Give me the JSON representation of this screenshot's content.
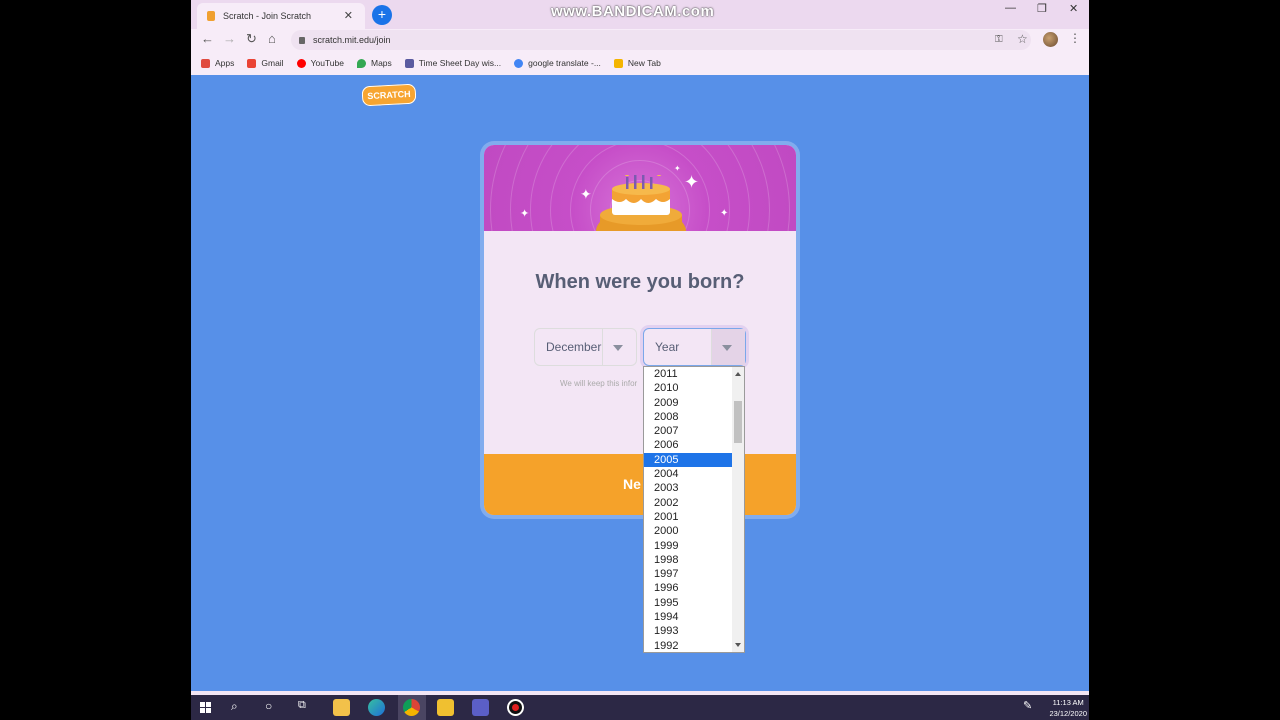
{
  "browser": {
    "tab_title": "Scratch - Join Scratch",
    "tab_close": "✕",
    "new_tab": "+",
    "watermark": "www.BANDICAM.com",
    "url": "scratch.mit.edu/join",
    "bookmarks": [
      {
        "label": "Apps",
        "color": "#e04a3f"
      },
      {
        "label": "Gmail",
        "color": "#ea4335"
      },
      {
        "label": "YouTube",
        "color": "#ff0000"
      },
      {
        "label": "Maps",
        "color": "#34a853"
      },
      {
        "label": "Time Sheet Day wis...",
        "color": "#5a5aa0"
      },
      {
        "label": "google translate -...",
        "color": "#4285f4"
      },
      {
        "label": "New Tab",
        "color": "#f4b400"
      }
    ]
  },
  "page": {
    "logo_text": "SCRATCH",
    "headline": "When were you born?",
    "month_select": "December",
    "year_select": "Year",
    "hint": "We will keep this infor",
    "next_label": "Ne",
    "year_options": [
      "2011",
      "2010",
      "2009",
      "2008",
      "2007",
      "2006",
      "2005",
      "2004",
      "2003",
      "2002",
      "2001",
      "2000",
      "1999",
      "1998",
      "1997",
      "1996",
      "1995",
      "1994",
      "1993",
      "1992"
    ],
    "selected_year": "2005"
  },
  "taskbar": {
    "time": "11:13 AM",
    "date": "23/12/2020"
  },
  "colors": {
    "page_bg": "#5790e8",
    "banner": "#c64ec8",
    "next_bar": "#f5a22a",
    "selection": "#1e74e8"
  }
}
